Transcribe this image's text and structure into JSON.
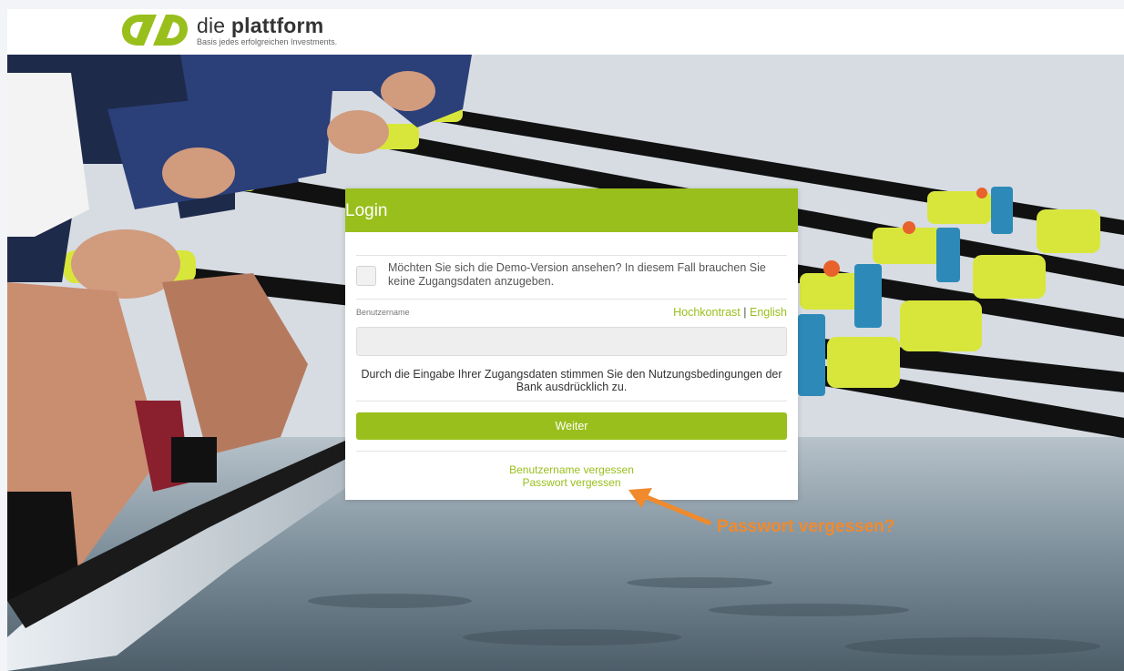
{
  "header": {
    "brand_prefix": "die ",
    "brand_bold": "plattform",
    "tagline": "Basis jedes erfolgreichen Investments.",
    "logo_color": "#99bf1c"
  },
  "login": {
    "title": "Login",
    "demo_text": "Möchten Sie sich die Demo-Version ansehen? In diesem Fall brauchen Sie keine Zugangsdaten anzugeben.",
    "username_label": "Benutzername",
    "username_value": "",
    "high_contrast_link": "Hochkontrast",
    "link_separator": "|",
    "english_link": "English",
    "terms_text": "Durch die Eingabe Ihrer Zugangsdaten stimmen Sie den Nutzungsbedingungen der Bank ausdrücklich zu.",
    "submit_label": "Weiter",
    "forgot_username": "Benutzername vergessen",
    "forgot_password": "Passwort vergessen"
  },
  "annotation": {
    "text": "Passwort vergessen?",
    "color": "#f08a2d"
  },
  "colors": {
    "accent": "#99bf1c",
    "page_bg": "#f2f4f7"
  }
}
